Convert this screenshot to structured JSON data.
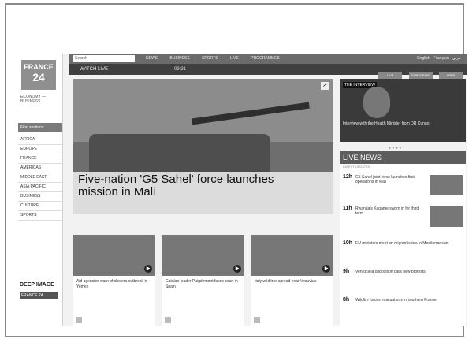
{
  "sidebar": {
    "logo_line1": "FRANCE",
    "logo_line2": "24",
    "caption": "ECONOMY — BUSINESS",
    "header": "Find sections",
    "nav": [
      "AFRICA",
      "EUROPE",
      "FRANCE",
      "AMERICAS",
      "MIDDLE EAST",
      "ASIA PACIFIC",
      "BUSINESS",
      "CULTURE",
      "SPORTS"
    ],
    "badge": "DEEP IMAGE",
    "badge2": "FRANCE 24"
  },
  "topbar": {
    "search_placeholder": "Search",
    "nav": [
      "NEWS",
      "BUSINESS",
      "SPORTS",
      "LIVE",
      "PROGRAMMES"
    ],
    "right": "English · Français · عربي"
  },
  "secbar": {
    "label": "WATCH LIVE",
    "time": "09:31",
    "buttons": [
      "LIVE",
      "SUBSCRIBE",
      "APPS"
    ]
  },
  "hero": {
    "headline": "Five-nation 'G5 Sahel' force launches mission in Mali"
  },
  "cards": [
    {
      "caption": "Aid agencies warn of cholera outbreak in Yemen"
    },
    {
      "caption": "Catalan leader Puigdemont faces court in Spain"
    },
    {
      "caption": "Italy wildfires spread near Vesuvius"
    }
  ],
  "video": {
    "tag": "THE INTERVIEW",
    "caption": "Interview with the Health Minister from DR Congo"
  },
  "live_news": {
    "title": "LIVE NEWS",
    "subtitle": "LATEST UPDATES",
    "items": [
      {
        "time": "12h",
        "text": "G5 Sahel joint force launches first operations in Mali"
      },
      {
        "time": "11h",
        "text": "Rwanda's Kagame sworn in for third term"
      },
      {
        "time": "10h",
        "text": "EU ministers meet on migrant crisis in Mediterranean"
      },
      {
        "time": "9h",
        "text": "Venezuela opposition calls new protests"
      },
      {
        "time": "8h",
        "text": "Wildfire forces evacuations in southern France"
      }
    ]
  }
}
